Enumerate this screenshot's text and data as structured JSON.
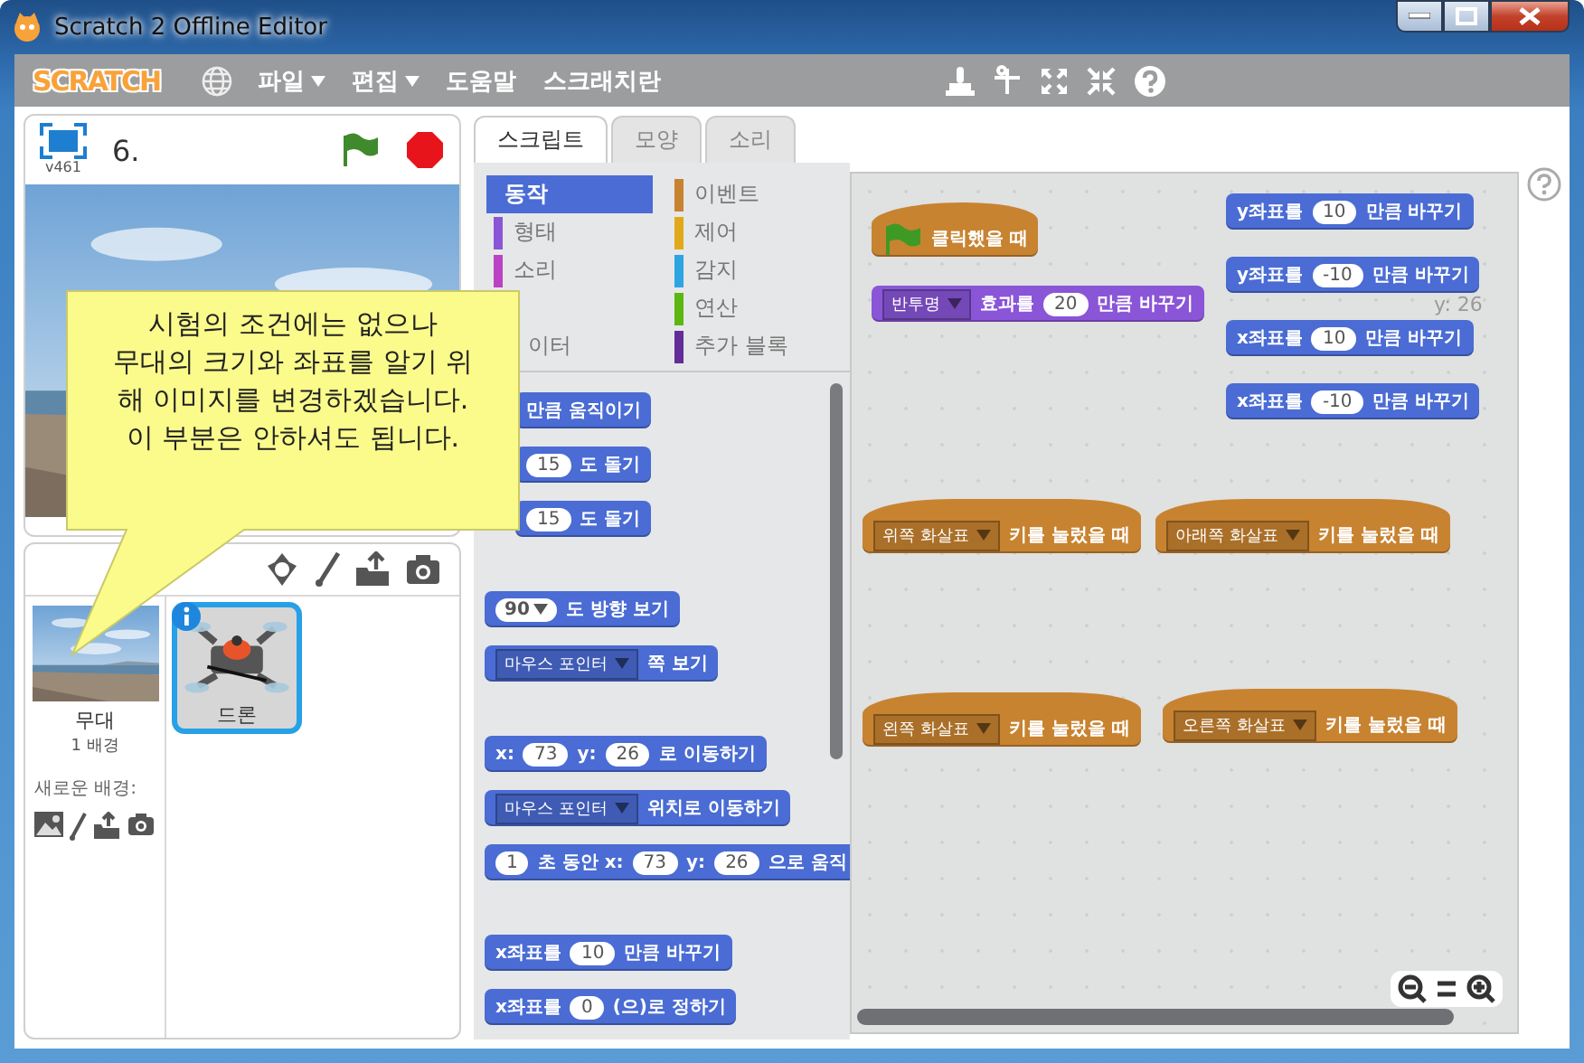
{
  "window": {
    "title": "Scratch 2 Offline Editor"
  },
  "menu_bar": {
    "logo": "SCRATCH",
    "items": [
      {
        "label": "파일",
        "dropdown": true
      },
      {
        "label": "편집",
        "dropdown": true
      },
      {
        "label": "도움말",
        "dropdown": false
      },
      {
        "label": "스크래치란",
        "dropdown": false
      }
    ]
  },
  "stage": {
    "version": "v461",
    "title": "6."
  },
  "sprites": {
    "stage_label": "무대",
    "backdrop_count": "1 배경",
    "new_backdrop_label": "새로운 배경:",
    "items": [
      {
        "name": "드론",
        "selected": true
      }
    ]
  },
  "tabs": [
    {
      "label": "스크립트",
      "selected": true
    },
    {
      "label": "모양",
      "selected": false
    },
    {
      "label": "소리",
      "selected": false
    }
  ],
  "categories": {
    "left": [
      {
        "label": "동작",
        "color": "#4a6cd4",
        "selected": true
      },
      {
        "label": "형태",
        "color": "#8a55d7",
        "selected": false
      },
      {
        "label": "소리",
        "color": "#bb42c3",
        "selected": false
      },
      {
        "label": "이터",
        "selected": false
      }
    ],
    "right": [
      {
        "label": "이벤트",
        "color": "#c88330",
        "selected": false
      },
      {
        "label": "제어",
        "color": "#e1a91a",
        "selected": false
      },
      {
        "label": "감지",
        "color": "#2ca5e2",
        "selected": false
      },
      {
        "label": "연산",
        "color": "#5cb712",
        "selected": false
      },
      {
        "label": "추가 블록",
        "color": "#632d99",
        "selected": false
      }
    ]
  },
  "palette": [
    [
      {
        "kind": "motion",
        "hat": false,
        "parts": [
          {
            "kind": "label",
            "text": "만큼 움직이기"
          }
        ]
      },
      {
        "kind": "motion",
        "hat": false,
        "parts": [
          {
            "kind": "number",
            "text": "15"
          },
          {
            "kind": "label",
            "text": "도 돌기"
          }
        ]
      },
      {
        "kind": "motion",
        "hat": false,
        "parts": [
          {
            "kind": "number",
            "text": "15"
          },
          {
            "kind": "label",
            "text": "도 돌기"
          }
        ]
      }
    ],
    [
      {
        "kind": "motion",
        "hat": false,
        "parts": [
          {
            "kind": "round-menu",
            "text": "90"
          },
          {
            "kind": "label",
            "text": "도 방향 보기"
          }
        ]
      },
      {
        "kind": "motion",
        "hat": false,
        "parts": [
          {
            "kind": "menu",
            "text": "마우스 포인터"
          },
          {
            "kind": "label",
            "text": "쪽 보기"
          }
        ]
      }
    ],
    [
      {
        "kind": "motion",
        "hat": false,
        "parts": [
          {
            "kind": "label",
            "text": "x:"
          },
          {
            "kind": "number",
            "text": "73"
          },
          {
            "kind": "label",
            "text": "y:"
          },
          {
            "kind": "number",
            "text": "26"
          },
          {
            "kind": "label",
            "text": "로 이동하기"
          }
        ]
      },
      {
        "kind": "motion",
        "hat": false,
        "parts": [
          {
            "kind": "menu",
            "text": "마우스 포인터"
          },
          {
            "kind": "label",
            "text": "위치로 이동하기"
          }
        ]
      },
      {
        "kind": "motion",
        "hat": false,
        "parts": [
          {
            "kind": "number",
            "text": "1"
          },
          {
            "kind": "label",
            "text": "초 동안 x:"
          },
          {
            "kind": "number",
            "text": "73"
          },
          {
            "kind": "label",
            "text": "y:"
          },
          {
            "kind": "number",
            "text": "26"
          },
          {
            "kind": "label",
            "text": "으로 움직"
          }
        ]
      }
    ],
    [
      {
        "kind": "motion",
        "hat": false,
        "parts": [
          {
            "kind": "label",
            "text": "x좌표를"
          },
          {
            "kind": "number",
            "text": "10"
          },
          {
            "kind": "label",
            "text": "만큼 바꾸기"
          }
        ]
      },
      {
        "kind": "motion",
        "hat": false,
        "parts": [
          {
            "kind": "label",
            "text": "x좌표를"
          },
          {
            "kind": "number",
            "text": "0"
          },
          {
            "kind": "label",
            "text": "(으)로 정하기"
          }
        ]
      }
    ]
  ],
  "script_area": {
    "ghost_readout": "y: 26",
    "blocks": [
      {
        "kind": "events",
        "hat": true,
        "parts": [
          {
            "kind": "flag"
          },
          {
            "kind": "label",
            "text": "클릭했을 때"
          }
        ]
      },
      {
        "kind": "looks",
        "hat": false,
        "parts": [
          {
            "kind": "menu",
            "text": "반투명"
          },
          {
            "kind": "label",
            "text": "효과를"
          },
          {
            "kind": "number",
            "text": "20"
          },
          {
            "kind": "label",
            "text": "만큼 바꾸기"
          }
        ]
      },
      {
        "kind": "motion",
        "hat": false,
        "parts": [
          {
            "kind": "label",
            "text": "y좌표를"
          },
          {
            "kind": "number",
            "text": "10"
          },
          {
            "kind": "label",
            "text": "만큼 바꾸기"
          }
        ]
      },
      {
        "kind": "motion",
        "hat": false,
        "parts": [
          {
            "kind": "label",
            "text": "y좌표를"
          },
          {
            "kind": "number",
            "text": "-10"
          },
          {
            "kind": "label",
            "text": "만큼 바꾸기"
          }
        ]
      },
      {
        "kind": "motion",
        "hat": false,
        "parts": [
          {
            "kind": "label",
            "text": "x좌표를"
          },
          {
            "kind": "number",
            "text": "10"
          },
          {
            "kind": "label",
            "text": "만큼 바꾸기"
          }
        ]
      },
      {
        "kind": "motion",
        "hat": false,
        "parts": [
          {
            "kind": "label",
            "text": "x좌표를"
          },
          {
            "kind": "number",
            "text": "-10"
          },
          {
            "kind": "label",
            "text": "만큼 바꾸기"
          }
        ]
      },
      {
        "kind": "events",
        "hat": true,
        "parts": [
          {
            "kind": "menu",
            "text": "위쪽 화살표"
          },
          {
            "kind": "label",
            "text": "키를 눌렀을 때"
          }
        ]
      },
      {
        "kind": "events",
        "hat": true,
        "parts": [
          {
            "kind": "menu",
            "text": "아래쪽 화살표"
          },
          {
            "kind": "label",
            "text": "키를 눌렀을 때"
          }
        ]
      },
      {
        "kind": "events",
        "hat": true,
        "parts": [
          {
            "kind": "menu",
            "text": "왼쪽 화살표"
          },
          {
            "kind": "label",
            "text": "키를 눌렀을 때"
          }
        ]
      },
      {
        "kind": "events",
        "hat": true,
        "parts": [
          {
            "kind": "menu",
            "text": "오른쪽 화살표"
          },
          {
            "kind": "label",
            "text": "키를 눌렀을 때"
          }
        ]
      }
    ]
  },
  "callout": {
    "text": "시험의 조건에는 없으나\n무대의 크기와 좌표를 알기 위\n해 이미지를 변경하겠습니다.\n이 부분은 안하셔도 됩니다."
  }
}
